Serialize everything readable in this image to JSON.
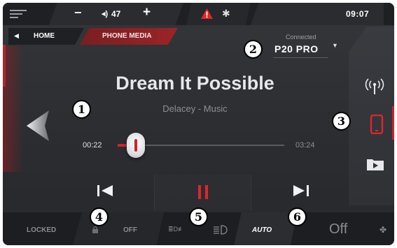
{
  "topbar": {
    "menu_icon": "menu-icon",
    "volume_minus": "−",
    "volume_icon": "◂)",
    "volume_value": "47",
    "volume_plus": "+",
    "warning_icon": "warning-triangle-icon",
    "bluetooth_icon": "bluetooth-icon",
    "bluetooth_glyph": "✱",
    "clock": "09:07"
  },
  "nav": {
    "home_arrow": "◀",
    "home_label": "HOME",
    "phone_media_label": "PHONE MEDIA"
  },
  "device": {
    "status": "Connected",
    "name": "P20 PRO",
    "dropdown": "▼"
  },
  "player": {
    "title": "Dream It Possible",
    "artist": "Delacey - Music",
    "time_current": "00:22",
    "time_total": "03:24",
    "progress": 0.11
  },
  "right_panel": {
    "items": [
      "radio-icon",
      "phone-icon",
      "folder-icon"
    ],
    "active": "phone-icon"
  },
  "controls": {
    "prev": "previous-track-icon",
    "play_pause": "pause-icon",
    "next": "next-track-icon"
  },
  "bottombar": {
    "locked_label": "LOCKED",
    "off_label": "OFF",
    "fog_glyph": "≣D≢",
    "auto_label": "AUTO",
    "off_big_label": "Off",
    "fan_glyph": "✤"
  },
  "callouts": [
    "1",
    "2",
    "3",
    "4",
    "5",
    "6"
  ],
  "colors": {
    "accent_red": "#d3202a",
    "tab_red": "#9b2429",
    "background": "#2b2d31"
  }
}
